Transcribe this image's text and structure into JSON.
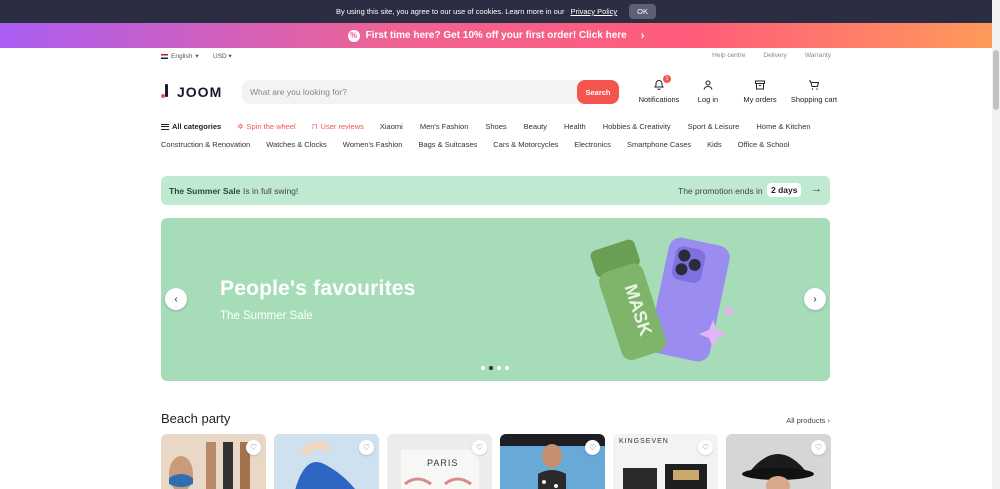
{
  "cookie": {
    "text": "By using this site, you agree to our use of cookies. Learn more in our",
    "link": "Privacy Policy",
    "ok": "OK"
  },
  "promo": {
    "text": "First time here? Get 10% off your first order! Click here",
    "icon": "percent-icon"
  },
  "topline": {
    "language": "English",
    "currency": "USD",
    "links": [
      "Help centre",
      "Delivery",
      "Warranty"
    ]
  },
  "logo": {
    "text": "JOOM"
  },
  "search": {
    "placeholder": "What are you looking for?",
    "button": "Search"
  },
  "header_actions": [
    {
      "label": "Notifications",
      "icon": "bell-icon",
      "badge": "1"
    },
    {
      "label": "Log in",
      "icon": "user-icon"
    },
    {
      "label": "My orders",
      "icon": "box-icon"
    },
    {
      "label": "Shopping cart",
      "icon": "cart-icon"
    }
  ],
  "categories": {
    "row1": [
      "All categories",
      "Spin the wheel",
      "User reviews",
      "Xiaomi",
      "Men's Fashion",
      "Shoes",
      "Beauty",
      "Health",
      "Hobbies & Creativity",
      "Sport & Leisure",
      "Home & Kitchen"
    ],
    "row2": [
      "Construction & Renovation",
      "Watches & Clocks",
      "Women's Fashion",
      "Bags & Suitcases",
      "Cars & Motorcycles",
      "Electronics",
      "Smartphone Cases",
      "Kids",
      "Office & School"
    ]
  },
  "sale_banner": {
    "title": "The Summer Sale",
    "subtitle": "Is in full swing!",
    "ends_label": "The promotion ends in",
    "days": "2 days"
  },
  "hero": {
    "title": "People's favourites",
    "subtitle": "The Summer Sale",
    "mask_text": "MASK",
    "slide_count": 4,
    "active_slide": 2
  },
  "section": {
    "title": "Beach party",
    "all_link": "All products",
    "products": [
      {
        "name": "product-bikini-set",
        "caption": "",
        "color": "#d9c3ad"
      },
      {
        "name": "product-slippers",
        "caption": "",
        "color": "#9cc3e0"
      },
      {
        "name": "product-sunglasses",
        "caption": "PARIS",
        "color": "#e8e8e8"
      },
      {
        "name": "product-swimsuit",
        "caption": "",
        "color": "#6fa9d6"
      },
      {
        "name": "product-watch-box",
        "caption": "KINGSEVEN",
        "color": "#f2f2f2"
      },
      {
        "name": "product-bucket-hat",
        "caption": "",
        "color": "#cfcfcf"
      }
    ]
  }
}
